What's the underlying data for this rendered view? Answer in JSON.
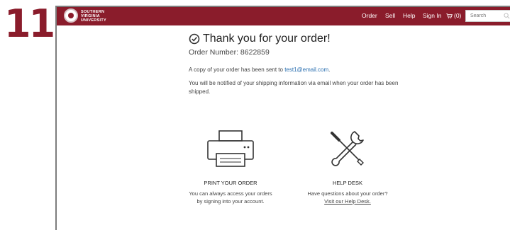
{
  "step": "11",
  "logo": {
    "line1": "SOUTHERN",
    "line2": "VIRGINIA",
    "line3": "UNIVERSITY"
  },
  "nav": {
    "order": "Order",
    "sell": "Sell",
    "help": "Help",
    "sign_in": "Sign In",
    "cart_count": "(0)",
    "search_placeholder": "Search"
  },
  "confirmation": {
    "title": "Thank you for your order!",
    "order_number": "Order Number: 8622859",
    "copy_text": "A copy of your order has been sent to ",
    "email": "test1@email.com",
    "copy_period": ".",
    "notify_text": "You will be notified of your shipping information via email when your order has been shipped."
  },
  "cards": {
    "print": {
      "title": "PRINT YOUR ORDER",
      "line1": "You can always access your orders",
      "line2": "by signing into your account."
    },
    "help": {
      "title": "HELP DESK",
      "line1": "Have questions about your order?",
      "link": "Visit our Help Desk."
    }
  },
  "colors": {
    "brand": "#8a1c2b",
    "link": "#2a6fb0"
  },
  "icons": {
    "check": "check-circle-icon",
    "printer": "printer-icon",
    "tools": "wrench-screwdriver-icon",
    "cart": "cart-icon",
    "search": "search-icon"
  }
}
